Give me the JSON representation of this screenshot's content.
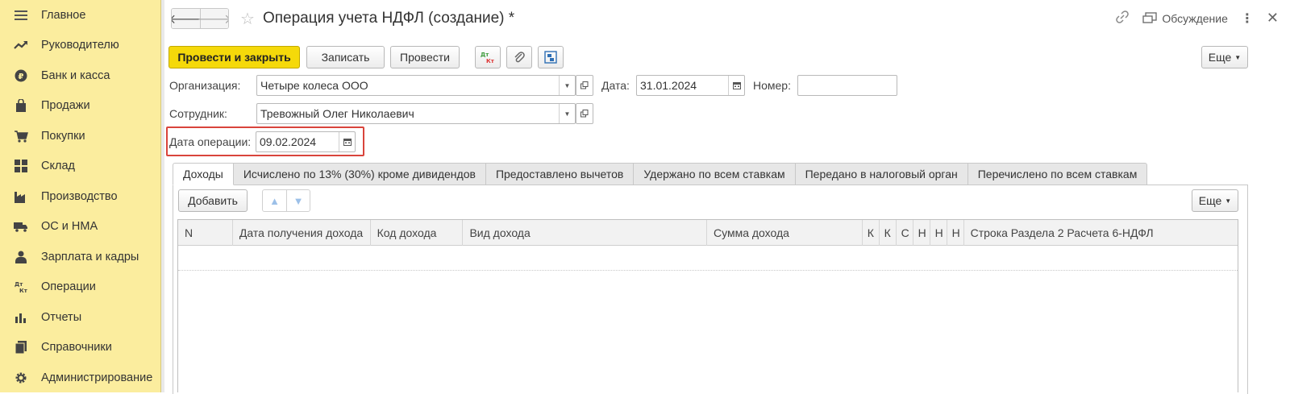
{
  "sidebar": {
    "items": [
      {
        "icon": "menu-icon",
        "label": "Главное"
      },
      {
        "icon": "trend-icon",
        "label": "Руководителю"
      },
      {
        "icon": "ruble-icon",
        "label": "Банк и касса"
      },
      {
        "icon": "bag-icon",
        "label": "Продажи"
      },
      {
        "icon": "cart-icon",
        "label": "Покупки"
      },
      {
        "icon": "warehouse-icon",
        "label": "Склад"
      },
      {
        "icon": "factory-icon",
        "label": "Производство"
      },
      {
        "icon": "truck-icon",
        "label": "ОС и НМА"
      },
      {
        "icon": "person-icon",
        "label": "Зарплата и кадры"
      },
      {
        "icon": "dt-kt-icon",
        "label": "Операции"
      },
      {
        "icon": "bar-chart-icon",
        "label": "Отчеты"
      },
      {
        "icon": "books-icon",
        "label": "Справочники"
      },
      {
        "icon": "gear-icon",
        "label": "Администрирование"
      }
    ]
  },
  "header": {
    "title": "Операция учета НДФЛ (создание) *",
    "discuss_label": "Обсуждение"
  },
  "toolbar": {
    "post_close": "Провести и закрыть",
    "save": "Записать",
    "post": "Провести",
    "more": "Еще"
  },
  "form": {
    "org_label": "Организация:",
    "org_value": "Четыре колеса ООО",
    "date_label": "Дата:",
    "date_value": "31.01.2024",
    "number_label": "Номер:",
    "number_value": "",
    "employee_label": "Сотрудник:",
    "employee_value": "Тревожный Олег Николаевич",
    "op_date_label": "Дата операции:",
    "op_date_value": "09.02.2024"
  },
  "tabs": [
    {
      "label": "Доходы",
      "active": true
    },
    {
      "label": "Исчислено по 13% (30%) кроме дивидендов",
      "active": false
    },
    {
      "label": "Предоставлено вычетов",
      "active": false
    },
    {
      "label": "Удержано по всем ставкам",
      "active": false
    },
    {
      "label": "Передано в налоговый орган",
      "active": false
    },
    {
      "label": "Перечислено по всем ставкам",
      "active": false
    }
  ],
  "table_toolbar": {
    "add": "Добавить",
    "more": "Еще"
  },
  "table": {
    "columns": [
      "N",
      "Дата получения дохода",
      "Код дохода",
      "Вид дохода",
      "Сумма дохода",
      "К",
      "К",
      "С",
      "Н",
      "Н",
      "Н",
      "Строка Раздела 2 Расчета 6-НДФЛ"
    ]
  },
  "colors": {
    "sidebar_bg": "#fbed9e",
    "primary_button": "#f5d90a",
    "highlight_border": "#d9443b"
  }
}
